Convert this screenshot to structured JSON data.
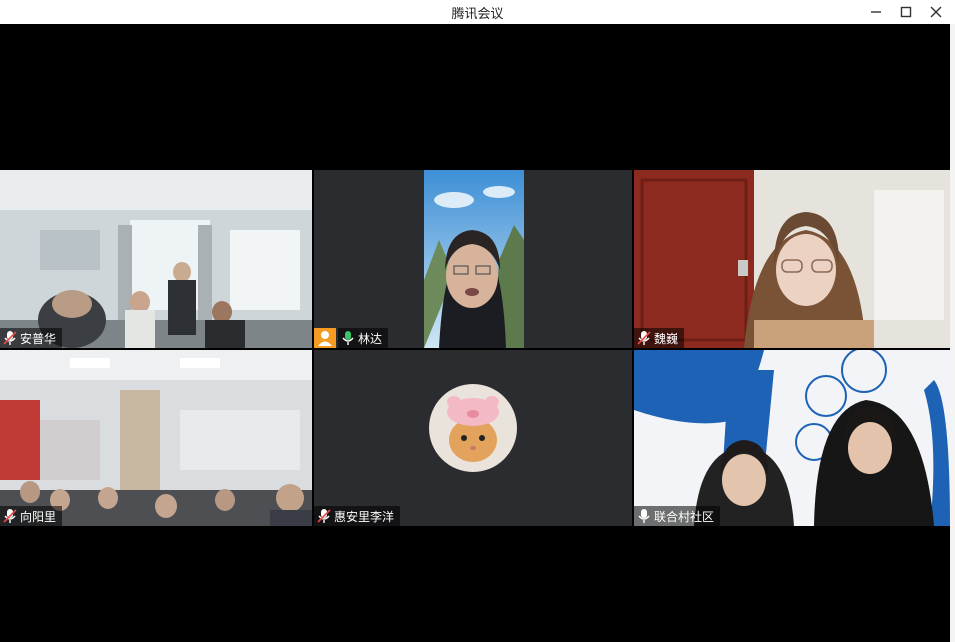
{
  "window": {
    "title": "腾讯会议",
    "icons": [
      "minimize-icon",
      "maximize-icon",
      "close-icon"
    ]
  },
  "participants": [
    {
      "name": "安普华",
      "mic": "muted"
    },
    {
      "name": "林达",
      "mic": "on",
      "role": "host",
      "speaking": true
    },
    {
      "name": "魏巍",
      "mic": "muted"
    },
    {
      "name": "向阳里",
      "mic": "muted"
    },
    {
      "name": "惠安里李洋",
      "mic": "muted"
    },
    {
      "name": "联合村社区",
      "mic": "on"
    }
  ],
  "colors": {
    "speaking_border": "#2db36b",
    "host_badge": "#f59a23",
    "mic_on": "#3cc46b"
  }
}
